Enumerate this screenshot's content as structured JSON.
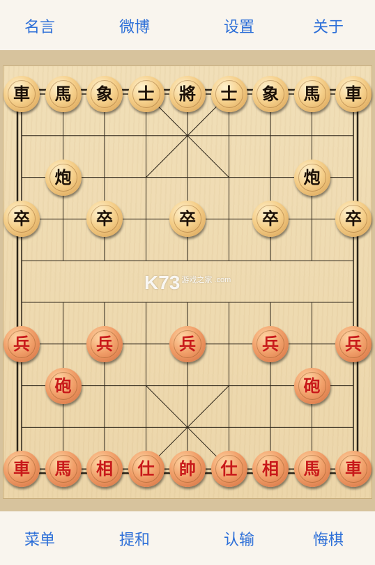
{
  "top_menu": [
    "名言",
    "微博",
    "设置",
    "关于"
  ],
  "bottom_menu": [
    "菜单",
    "提和",
    "认输",
    "悔棋"
  ],
  "watermark": {
    "brand": "K73",
    "sub": "游戏之家 .com"
  },
  "colors": {
    "link": "#2d6fd8",
    "red_piece_text": "#c8191a",
    "black_piece_text": "#1b1007",
    "board": "#eed9ae"
  },
  "board": {
    "columns": 9,
    "rows": 10
  },
  "pieces": [
    {
      "side": "black",
      "char": "車",
      "file": 0,
      "rank": 0
    },
    {
      "side": "black",
      "char": "馬",
      "file": 1,
      "rank": 0
    },
    {
      "side": "black",
      "char": "象",
      "file": 2,
      "rank": 0
    },
    {
      "side": "black",
      "char": "士",
      "file": 3,
      "rank": 0
    },
    {
      "side": "black",
      "char": "將",
      "file": 4,
      "rank": 0
    },
    {
      "side": "black",
      "char": "士",
      "file": 5,
      "rank": 0
    },
    {
      "side": "black",
      "char": "象",
      "file": 6,
      "rank": 0
    },
    {
      "side": "black",
      "char": "馬",
      "file": 7,
      "rank": 0
    },
    {
      "side": "black",
      "char": "車",
      "file": 8,
      "rank": 0
    },
    {
      "side": "black",
      "char": "炮",
      "file": 1,
      "rank": 2
    },
    {
      "side": "black",
      "char": "炮",
      "file": 7,
      "rank": 2
    },
    {
      "side": "black",
      "char": "卒",
      "file": 0,
      "rank": 3
    },
    {
      "side": "black",
      "char": "卒",
      "file": 2,
      "rank": 3
    },
    {
      "side": "black",
      "char": "卒",
      "file": 4,
      "rank": 3
    },
    {
      "side": "black",
      "char": "卒",
      "file": 6,
      "rank": 3
    },
    {
      "side": "black",
      "char": "卒",
      "file": 8,
      "rank": 3
    },
    {
      "side": "red",
      "char": "兵",
      "file": 0,
      "rank": 6
    },
    {
      "side": "red",
      "char": "兵",
      "file": 2,
      "rank": 6
    },
    {
      "side": "red",
      "char": "兵",
      "file": 4,
      "rank": 6
    },
    {
      "side": "red",
      "char": "兵",
      "file": 6,
      "rank": 6
    },
    {
      "side": "red",
      "char": "兵",
      "file": 8,
      "rank": 6
    },
    {
      "side": "red",
      "char": "砲",
      "file": 1,
      "rank": 7
    },
    {
      "side": "red",
      "char": "砲",
      "file": 7,
      "rank": 7
    },
    {
      "side": "red",
      "char": "車",
      "file": 0,
      "rank": 9
    },
    {
      "side": "red",
      "char": "馬",
      "file": 1,
      "rank": 9
    },
    {
      "side": "red",
      "char": "相",
      "file": 2,
      "rank": 9
    },
    {
      "side": "red",
      "char": "仕",
      "file": 3,
      "rank": 9
    },
    {
      "side": "red",
      "char": "帥",
      "file": 4,
      "rank": 9
    },
    {
      "side": "red",
      "char": "仕",
      "file": 5,
      "rank": 9
    },
    {
      "side": "red",
      "char": "相",
      "file": 6,
      "rank": 9
    },
    {
      "side": "red",
      "char": "馬",
      "file": 7,
      "rank": 9
    },
    {
      "side": "red",
      "char": "車",
      "file": 8,
      "rank": 9
    }
  ]
}
